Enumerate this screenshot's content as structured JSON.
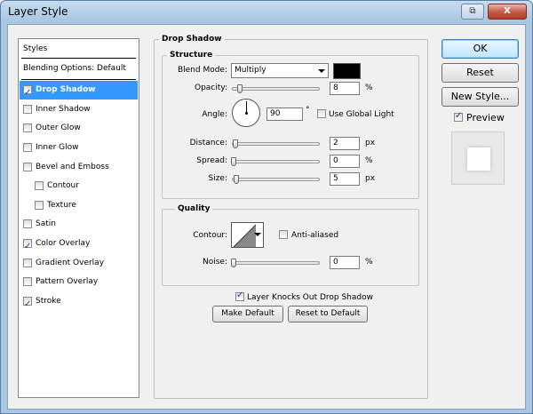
{
  "window": {
    "title": "Layer Style",
    "sys_restore": "⧉",
    "sys_close": "X"
  },
  "styles_panel": {
    "header": "Styles",
    "blending": "Blending Options: Default",
    "items": [
      {
        "label": "Drop Shadow",
        "checked": true,
        "selected": true
      },
      {
        "label": "Inner Shadow",
        "checked": false
      },
      {
        "label": "Outer Glow",
        "checked": false
      },
      {
        "label": "Inner Glow",
        "checked": false
      },
      {
        "label": "Bevel and Emboss",
        "checked": false
      },
      {
        "label": "Contour",
        "checked": false
      },
      {
        "label": "Texture",
        "checked": false
      },
      {
        "label": "Satin",
        "checked": false
      },
      {
        "label": "Color Overlay",
        "checked": true
      },
      {
        "label": "Gradient Overlay",
        "checked": false
      },
      {
        "label": "Pattern Overlay",
        "checked": false
      },
      {
        "label": "Stroke",
        "checked": true
      }
    ]
  },
  "drop_shadow": {
    "title": "Drop Shadow",
    "structure": {
      "title": "Structure",
      "blend_mode_label": "Blend Mode:",
      "blend_mode_value": "Multiply",
      "shadow_color": "#000000",
      "opacity_label": "Opacity:",
      "opacity_value": "8",
      "opacity_unit": "%",
      "angle_label": "Angle:",
      "angle_value": "90",
      "angle_unit": "°",
      "global_light_label": "Use Global Light",
      "distance_label": "Distance:",
      "distance_value": "2",
      "distance_unit": "px",
      "spread_label": "Spread:",
      "spread_value": "0",
      "spread_unit": "%",
      "size_label": "Size:",
      "size_value": "5",
      "size_unit": "px"
    },
    "quality": {
      "title": "Quality",
      "contour_label": "Contour:",
      "anti_aliased_label": "Anti-aliased",
      "noise_label": "Noise:",
      "noise_value": "0",
      "noise_unit": "%"
    },
    "knockout_label": "Layer Knocks Out Drop Shadow",
    "make_default": "Make Default",
    "reset_default": "Reset to Default"
  },
  "actions": {
    "ok": "OK",
    "reset": "Reset",
    "new_style": "New Style...",
    "preview_label": "Preview"
  }
}
